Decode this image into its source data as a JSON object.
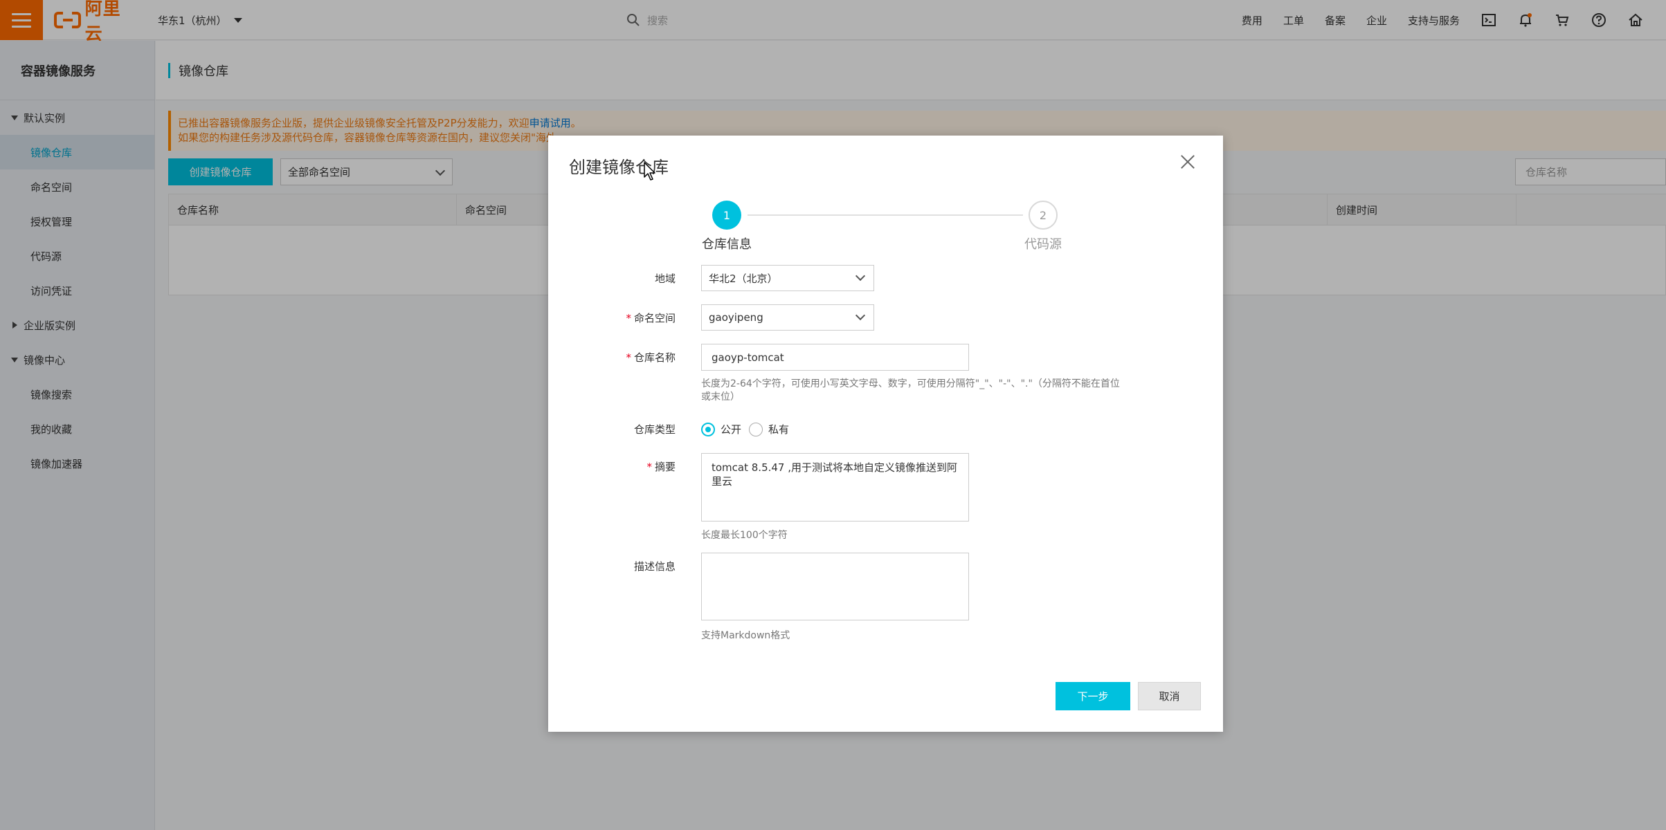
{
  "topbar": {
    "logo_text": "阿里云",
    "region": "华东1（杭州）",
    "search_placeholder": "搜索",
    "nav": [
      "费用",
      "工单",
      "备案",
      "企业",
      "支持与服务"
    ],
    "icons": [
      "terminal-icon",
      "bell-icon",
      "cart-icon",
      "help-icon",
      "home-icon"
    ]
  },
  "sidebar": {
    "title": "容器镜像服务",
    "groups": {
      "default": "默认实例",
      "enterprise": "企业版实例",
      "center": "镜像中心"
    },
    "default_items": [
      "镜像仓库",
      "命名空间",
      "授权管理",
      "代码源",
      "访问凭证"
    ],
    "center_items": [
      "镜像搜索",
      "我的收藏",
      "镜像加速器"
    ]
  },
  "main": {
    "page_title": "镜像仓库",
    "notice_line1_prefix": "已推出容器镜像服务企业版，提供企业级镜像安全托管及P2P分发能力，欢迎",
    "notice_link": "申请试用",
    "notice_line1_suffix": "。",
    "notice_line2": "如果您的构建任务涉及源代码仓库，容器镜像仓库等资源在国内，建议您关闭\"海外",
    "create_button": "创建镜像仓库",
    "namespace_filter": "全部命名空间",
    "repo_search_placeholder": "仓库名称",
    "table_headers": [
      "仓库名称",
      "命名空间",
      "创建时间"
    ]
  },
  "modal": {
    "title": "创建镜像仓库",
    "steps": [
      {
        "num": "1",
        "label": "仓库信息"
      },
      {
        "num": "2",
        "label": "代码源"
      }
    ],
    "fields": {
      "region_label": "地域",
      "region_value": "华北2（北京）",
      "namespace_label": "命名空间",
      "namespace_value": "gaoyipeng",
      "repo_name_label": "仓库名称",
      "repo_name_value": "gaoyp-tomcat",
      "repo_name_hint_1": "长度为2-64个字符，可使用小写英文字母、数字，可使用分隔符\"_\"、\"-\"、\".\"（分隔符不能在首位",
      "repo_name_hint_2": "或末位）",
      "repo_type_label": "仓库类型",
      "repo_type_public": "公开",
      "repo_type_private": "私有",
      "repo_type_selected": "公开",
      "summary_label": "摘要",
      "summary_value": "tomcat 8.5.47 ,用于测试将本地自定义镜像推送到阿里云",
      "summary_hint": "长度最长100个字符",
      "description_label": "描述信息",
      "description_value": "",
      "description_hint": "支持Markdown格式"
    },
    "next_button": "下一步",
    "cancel_button": "取消"
  },
  "colors": {
    "brand": "#ff6a00",
    "accent": "#00c1de",
    "required": "#e6001f",
    "notice_text": "#f07b14"
  }
}
